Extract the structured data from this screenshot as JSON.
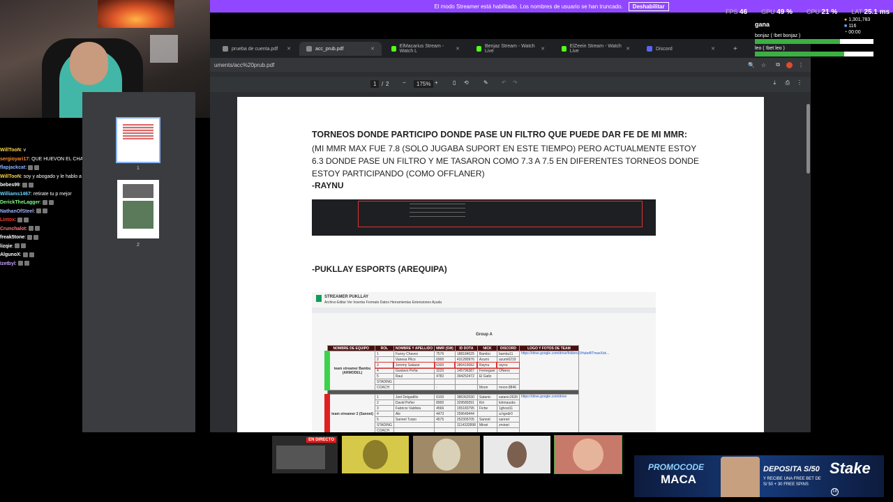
{
  "banner": {
    "text": "El modo Streamer está habilitado. Los nombres de usuario se han truncado.",
    "button": "Deshabilitar"
  },
  "stats": {
    "fps_label": "FPS",
    "fps": "46",
    "gpu_label": "GPU",
    "gpu": "49 %",
    "cpu_label": "CPU",
    "cpu": "21 %",
    "lat_label": "LAT",
    "lat": "25.1 ms"
  },
  "chat": [
    {
      "user": "WillTooN",
      "color": "#ffd84d",
      "msg": "v"
    },
    {
      "user": "sergioyari17",
      "color": "#ff8c2e",
      "msg": "QUE HUEVON EL CHAVALITO, YA LA CAGO"
    },
    {
      "user": "flapjackcat",
      "color": "#8ab4ff",
      "msg": ""
    },
    {
      "user": "WillTooN",
      "color": "#ffd84d",
      "msg": "soy y abogado y le hablo a mi abogado"
    },
    {
      "user": "bebes99",
      "color": "#ffffff",
      "msg": ""
    },
    {
      "user": "Williams1467",
      "color": "#6fd3ff",
      "msg": "retirate tu p mejor"
    },
    {
      "user": "DerickTheLagger",
      "color": "#7fff7f",
      "msg": ""
    },
    {
      "user": "NathanOfSteel",
      "color": "#9fb4ff",
      "msg": ""
    },
    {
      "user": "Lintox",
      "color": "#ff3b3b",
      "msg": ""
    },
    {
      "user": "Crunchalot",
      "color": "#ff7a7a",
      "msg": ""
    },
    {
      "user": "freak5tone",
      "color": "#ffffff",
      "msg": ""
    },
    {
      "user": "lizqie",
      "color": "#ffffff",
      "msg": ""
    },
    {
      "user": "AlgunoX",
      "color": "#ffffff",
      "msg": ""
    },
    {
      "user": "Izetbyl",
      "color": "#c7a0ff",
      "msg": ""
    }
  ],
  "browser": {
    "tabs": [
      {
        "label": "prueba de cuenta.pdf",
        "color": "#888"
      },
      {
        "label": "acc_prub.pdf",
        "color": "#888"
      },
      {
        "label": "ElMacarius Stream - Watch L",
        "color": "#53fc18"
      },
      {
        "label": "Benjaz Stream - Watch Live",
        "color": "#53fc18"
      },
      {
        "label": "ElZeein Stream - Watch Live",
        "color": "#53fc18"
      },
      {
        "label": "Discord",
        "color": "#5865f2"
      }
    ],
    "new_tab": "+",
    "address": "uments/acc%20prub.pdf",
    "pdf": {
      "page_current": "1",
      "page_sep": "/",
      "page_total": "2",
      "zoom": "175%"
    },
    "thumbs": [
      "1",
      "2"
    ]
  },
  "document": {
    "heading": "TORNEOS DONDE PARTICIPO DONDE PASE UN FILTRO QUE PUEDE DAR FE DE MI MMR:",
    "paragraph": "(MI MMR MAX FUE 7.8 (SOLO JUGABA SUPORT EN ESTE TIEMPO) PERO ACTUALMENTE ESTOY 6.3 DONDE PASE UN FILTRO Y ME TASARON COMO 7.3 A 7.5 EN DIFERENTES TORNEOS DONDE ESTOY PARTICIPANDO (COMO OFFLANER)",
    "signature": "-RAYNU",
    "section2": "-PUKLLAY ESPORTS (AREQUIPA)",
    "sheet": {
      "title": "STREAMER PUKLLAY",
      "menu": "Archivo  Editar  Ver  Insertar  Formato  Datos  Herramientas  Extensiones  Ayuda",
      "group": "Group A",
      "headers": [
        "NOMBRE DE EQUIPO",
        "ROL",
        "NOMBRE Y APELLIDO",
        "MMR (SW)",
        "ID DOTA",
        "NICK",
        "DISCORD",
        "LOGO Y FOTOS DE TEAM"
      ],
      "team1": "team streamer Bambu (ARMODEL)",
      "team2": "team streamer 2 (Sannet)",
      "rows1": [
        [
          "1",
          "Fanny Chavez",
          "7576",
          "188184025",
          "Bambú",
          "bambu11"
        ],
        [
          "2",
          "Vanesa Pilco",
          "6900",
          "431280976",
          "Azumi",
          "azumi6219"
        ],
        [
          "3",
          "Jeremy Salazar",
          "6300",
          "386419082",
          "Raynu",
          "raynu"
        ],
        [
          "4",
          "Gustavo Peña",
          "3220",
          "145796387",
          "Ferneguer",
          "ONeno"
        ],
        [
          "5",
          "Raul",
          "4782",
          "394252472",
          "El Gallo",
          ""
        ],
        [
          "STADING",
          "",
          "",
          "",
          "",
          ""
        ],
        [
          "COACH",
          "",
          "-",
          "",
          "Moon",
          "moon.8846"
        ]
      ],
      "rows2": [
        [
          "1",
          "Joel Delgadillo",
          "6100",
          "386362030",
          "Satanic",
          "satanic2639"
        ],
        [
          "2",
          "David Peñer",
          "8900",
          "329589391",
          "Kiri",
          "kirimauoks"
        ],
        [
          "3",
          "Fabricio Valdivia",
          "4566",
          "155183795",
          "Fiche",
          "1ghost11"
        ],
        [
          "4",
          "Ale",
          "4473",
          "259649444",
          "",
          "a.hgndr0"
        ],
        [
          "5",
          "Sannet Turpo",
          "4575",
          "252305705",
          "Sannet",
          "sannet"
        ],
        [
          "STADING",
          "",
          "",
          "1114332898",
          "Mirari",
          "zmirari"
        ],
        [
          "COACH",
          "",
          "",
          "",
          "",
          ""
        ]
      ],
      "link1": "https://drive.google.com/drive/folders/1HubeBTmaxXzk...",
      "link2": "https://drive.google.com/drive"
    }
  },
  "poll": {
    "title": "gana",
    "options": [
      {
        "label": "bonjaz ( !bet bonjaz )",
        "fill": 0.72
      },
      {
        "label": "leo ( !bet leo )",
        "fill": 0.75
      }
    ],
    "metrics": [
      "1,301,783",
      "116",
      "00:00"
    ]
  },
  "live_label": "EN DIRECTO",
  "promo": {
    "code_label": "PROMOCODE",
    "code": "MACA",
    "deposit": "DEPOSITA S/50",
    "sub": "Y RECIBE UNA FREE BET DE S/ 50 + 30 FREE SPINS",
    "brand": "Stake",
    "age": "18"
  },
  "colors": {
    "accent": "#9147ff",
    "pdf_bg": "#2d2e31",
    "poll_fill": "#3cb043"
  }
}
